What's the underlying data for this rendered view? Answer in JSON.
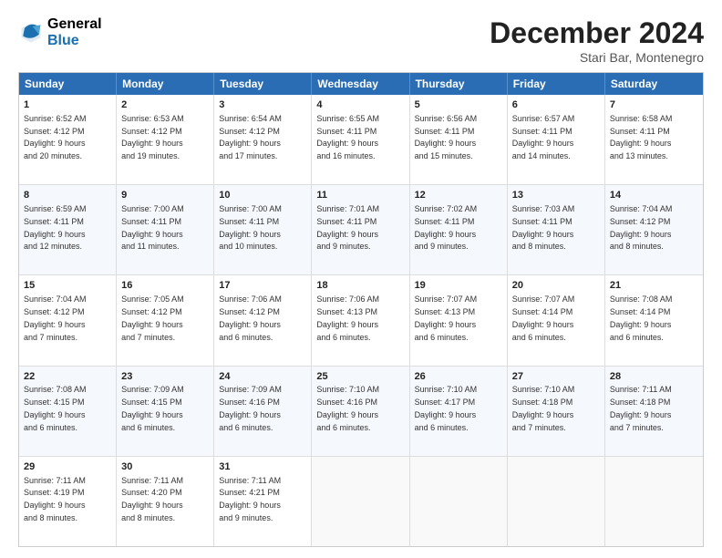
{
  "header": {
    "logo_general": "General",
    "logo_blue": "Blue",
    "month_title": "December 2024",
    "subtitle": "Stari Bar, Montenegro"
  },
  "days_of_week": [
    "Sunday",
    "Monday",
    "Tuesday",
    "Wednesday",
    "Thursday",
    "Friday",
    "Saturday"
  ],
  "weeks": [
    [
      {
        "day": "1",
        "lines": [
          "Sunrise: 6:52 AM",
          "Sunset: 4:12 PM",
          "Daylight: 9 hours",
          "and 20 minutes."
        ]
      },
      {
        "day": "2",
        "lines": [
          "Sunrise: 6:53 AM",
          "Sunset: 4:12 PM",
          "Daylight: 9 hours",
          "and 19 minutes."
        ]
      },
      {
        "day": "3",
        "lines": [
          "Sunrise: 6:54 AM",
          "Sunset: 4:12 PM",
          "Daylight: 9 hours",
          "and 17 minutes."
        ]
      },
      {
        "day": "4",
        "lines": [
          "Sunrise: 6:55 AM",
          "Sunset: 4:11 PM",
          "Daylight: 9 hours",
          "and 16 minutes."
        ]
      },
      {
        "day": "5",
        "lines": [
          "Sunrise: 6:56 AM",
          "Sunset: 4:11 PM",
          "Daylight: 9 hours",
          "and 15 minutes."
        ]
      },
      {
        "day": "6",
        "lines": [
          "Sunrise: 6:57 AM",
          "Sunset: 4:11 PM",
          "Daylight: 9 hours",
          "and 14 minutes."
        ]
      },
      {
        "day": "7",
        "lines": [
          "Sunrise: 6:58 AM",
          "Sunset: 4:11 PM",
          "Daylight: 9 hours",
          "and 13 minutes."
        ]
      }
    ],
    [
      {
        "day": "8",
        "lines": [
          "Sunrise: 6:59 AM",
          "Sunset: 4:11 PM",
          "Daylight: 9 hours",
          "and 12 minutes."
        ]
      },
      {
        "day": "9",
        "lines": [
          "Sunrise: 7:00 AM",
          "Sunset: 4:11 PM",
          "Daylight: 9 hours",
          "and 11 minutes."
        ]
      },
      {
        "day": "10",
        "lines": [
          "Sunrise: 7:00 AM",
          "Sunset: 4:11 PM",
          "Daylight: 9 hours",
          "and 10 minutes."
        ]
      },
      {
        "day": "11",
        "lines": [
          "Sunrise: 7:01 AM",
          "Sunset: 4:11 PM",
          "Daylight: 9 hours",
          "and 9 minutes."
        ]
      },
      {
        "day": "12",
        "lines": [
          "Sunrise: 7:02 AM",
          "Sunset: 4:11 PM",
          "Daylight: 9 hours",
          "and 9 minutes."
        ]
      },
      {
        "day": "13",
        "lines": [
          "Sunrise: 7:03 AM",
          "Sunset: 4:11 PM",
          "Daylight: 9 hours",
          "and 8 minutes."
        ]
      },
      {
        "day": "14",
        "lines": [
          "Sunrise: 7:04 AM",
          "Sunset: 4:12 PM",
          "Daylight: 9 hours",
          "and 8 minutes."
        ]
      }
    ],
    [
      {
        "day": "15",
        "lines": [
          "Sunrise: 7:04 AM",
          "Sunset: 4:12 PM",
          "Daylight: 9 hours",
          "and 7 minutes."
        ]
      },
      {
        "day": "16",
        "lines": [
          "Sunrise: 7:05 AM",
          "Sunset: 4:12 PM",
          "Daylight: 9 hours",
          "and 7 minutes."
        ]
      },
      {
        "day": "17",
        "lines": [
          "Sunrise: 7:06 AM",
          "Sunset: 4:12 PM",
          "Daylight: 9 hours",
          "and 6 minutes."
        ]
      },
      {
        "day": "18",
        "lines": [
          "Sunrise: 7:06 AM",
          "Sunset: 4:13 PM",
          "Daylight: 9 hours",
          "and 6 minutes."
        ]
      },
      {
        "day": "19",
        "lines": [
          "Sunrise: 7:07 AM",
          "Sunset: 4:13 PM",
          "Daylight: 9 hours",
          "and 6 minutes."
        ]
      },
      {
        "day": "20",
        "lines": [
          "Sunrise: 7:07 AM",
          "Sunset: 4:14 PM",
          "Daylight: 9 hours",
          "and 6 minutes."
        ]
      },
      {
        "day": "21",
        "lines": [
          "Sunrise: 7:08 AM",
          "Sunset: 4:14 PM",
          "Daylight: 9 hours",
          "and 6 minutes."
        ]
      }
    ],
    [
      {
        "day": "22",
        "lines": [
          "Sunrise: 7:08 AM",
          "Sunset: 4:15 PM",
          "Daylight: 9 hours",
          "and 6 minutes."
        ]
      },
      {
        "day": "23",
        "lines": [
          "Sunrise: 7:09 AM",
          "Sunset: 4:15 PM",
          "Daylight: 9 hours",
          "and 6 minutes."
        ]
      },
      {
        "day": "24",
        "lines": [
          "Sunrise: 7:09 AM",
          "Sunset: 4:16 PM",
          "Daylight: 9 hours",
          "and 6 minutes."
        ]
      },
      {
        "day": "25",
        "lines": [
          "Sunrise: 7:10 AM",
          "Sunset: 4:16 PM",
          "Daylight: 9 hours",
          "and 6 minutes."
        ]
      },
      {
        "day": "26",
        "lines": [
          "Sunrise: 7:10 AM",
          "Sunset: 4:17 PM",
          "Daylight: 9 hours",
          "and 6 minutes."
        ]
      },
      {
        "day": "27",
        "lines": [
          "Sunrise: 7:10 AM",
          "Sunset: 4:18 PM",
          "Daylight: 9 hours",
          "and 7 minutes."
        ]
      },
      {
        "day": "28",
        "lines": [
          "Sunrise: 7:11 AM",
          "Sunset: 4:18 PM",
          "Daylight: 9 hours",
          "and 7 minutes."
        ]
      }
    ],
    [
      {
        "day": "29",
        "lines": [
          "Sunrise: 7:11 AM",
          "Sunset: 4:19 PM",
          "Daylight: 9 hours",
          "and 8 minutes."
        ]
      },
      {
        "day": "30",
        "lines": [
          "Sunrise: 7:11 AM",
          "Sunset: 4:20 PM",
          "Daylight: 9 hours",
          "and 8 minutes."
        ]
      },
      {
        "day": "31",
        "lines": [
          "Sunrise: 7:11 AM",
          "Sunset: 4:21 PM",
          "Daylight: 9 hours",
          "and 9 minutes."
        ]
      },
      {
        "day": "",
        "lines": []
      },
      {
        "day": "",
        "lines": []
      },
      {
        "day": "",
        "lines": []
      },
      {
        "day": "",
        "lines": []
      }
    ]
  ]
}
